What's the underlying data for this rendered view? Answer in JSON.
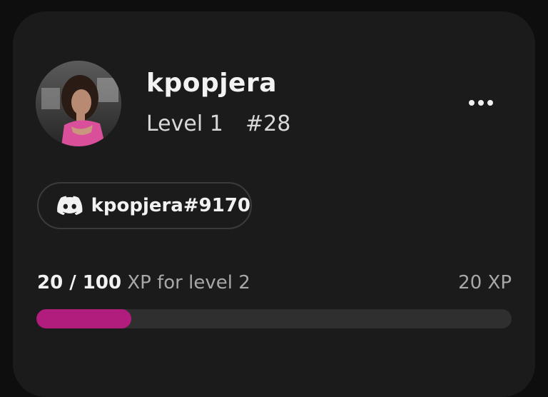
{
  "profile": {
    "username": "kpopjera",
    "level_label": "Level 1",
    "rank": "#28"
  },
  "discord": {
    "icon": "discord-icon",
    "tag": "kpopjera#9170"
  },
  "xp": {
    "current": "20",
    "separator": " / ",
    "required": "100",
    "label": " XP for level 2",
    "total": "20 XP",
    "progress_fraction": 0.2,
    "bar_color": "#b01d7c",
    "track_color": "#2f2f2f"
  },
  "menu": {
    "icon": "more-options-icon"
  }
}
